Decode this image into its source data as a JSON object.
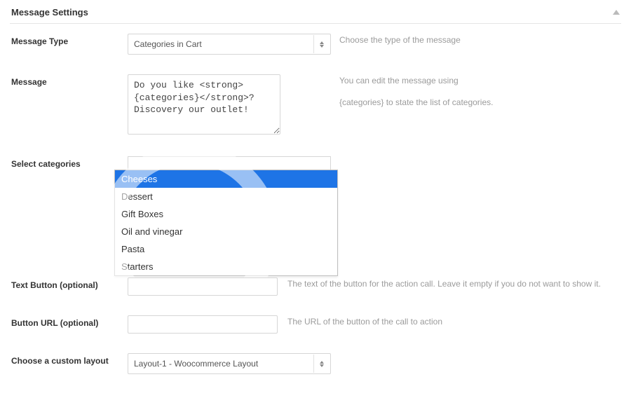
{
  "panel": {
    "title": "Message Settings"
  },
  "message_type": {
    "label": "Message Type",
    "value": "Categories in Cart",
    "help": "Choose the type of the message"
  },
  "message": {
    "label": "Message",
    "value": "Do you like <strong>{categories}</strong>? Discovery our outlet!",
    "help1": "You can edit the message using",
    "help2": "{categories} to state the list of categories."
  },
  "select_categories": {
    "label": "Select categories",
    "options": [
      "Cheeses",
      "Dessert",
      "Gift Boxes",
      "Oil and vinegar",
      "Pasta",
      "Starters"
    ],
    "highlighted_index": 0
  },
  "text_button": {
    "label": "Text Button (optional)",
    "value": "",
    "help": "The text of the button for the action call. Leave it empty if you do not want to show it."
  },
  "button_url": {
    "label": "Button URL (optional)",
    "value": "",
    "help": "The URL of the button of the call to action"
  },
  "custom_layout": {
    "label": "Choose a custom layout",
    "value": "Layout-1 - Woocommerce Layout"
  }
}
